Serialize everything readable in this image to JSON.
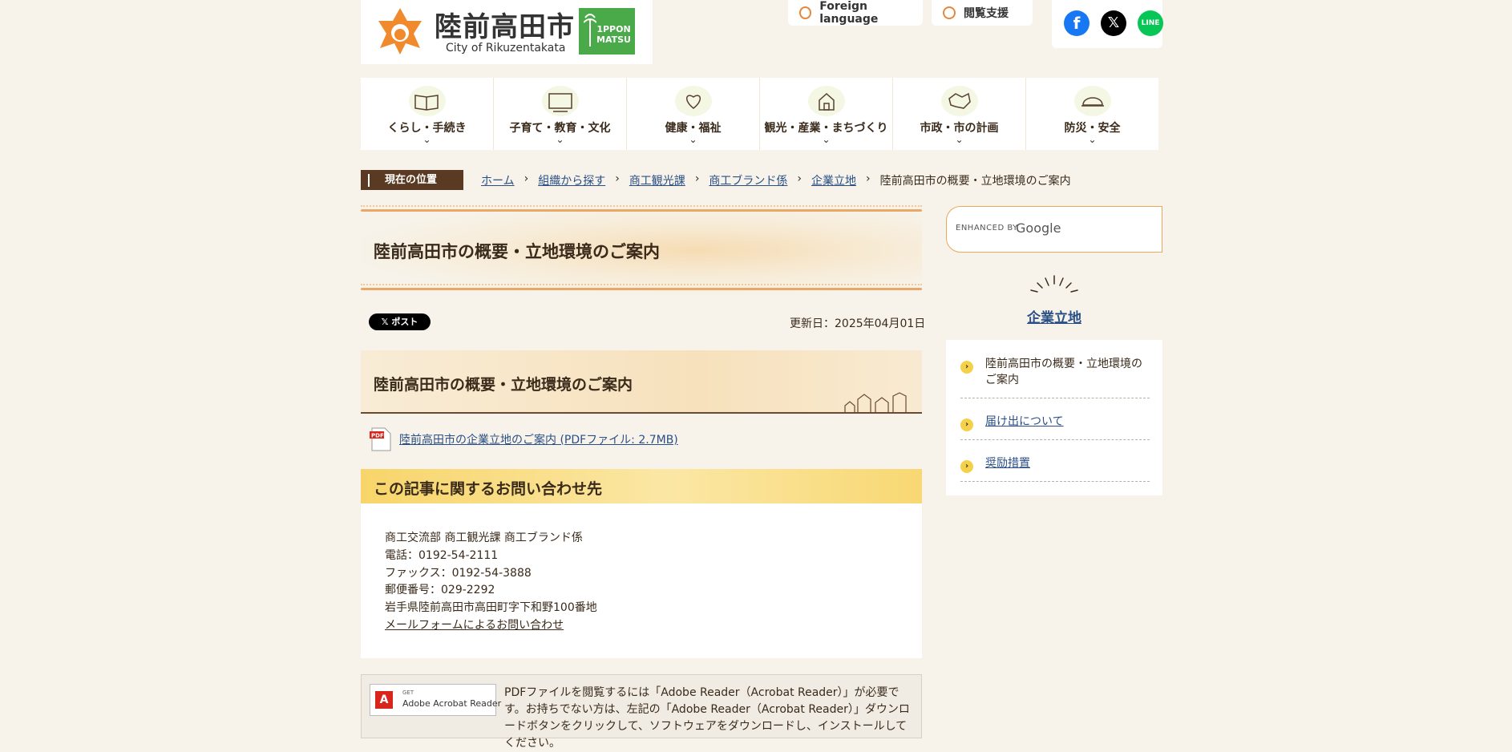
{
  "header": {
    "logo_name": "陸前高田市",
    "logo_sub": "City of Rikuzentakata",
    "ippon": [
      "1PPON",
      "MATSU"
    ],
    "foreign_label": "Foreign language",
    "eturan_label": "閲覧支援",
    "sns": {
      "x_glyph": "𝕏",
      "line_text": "LINE",
      "fb_glyph": "f"
    }
  },
  "nav": {
    "items": [
      {
        "label": "くらし・手続き",
        "icon": "book-pencil-icon"
      },
      {
        "label": "子育て・教育・文化",
        "icon": "blackboard-icon"
      },
      {
        "label": "健康・福祉",
        "icon": "hand-heart-icon"
      },
      {
        "label": "観光・産業・まちづくり",
        "icon": "town-icon"
      },
      {
        "label": "市政・市の計画",
        "icon": "map-icon"
      },
      {
        "label": "防災・安全",
        "icon": "helmet-icon"
      }
    ],
    "chevron": "⌄"
  },
  "breadcrumb": {
    "tag": "現在の位置",
    "items": [
      "ホーム",
      "組織から探す",
      "商工観光課",
      "商工ブランド係",
      "企業立地"
    ],
    "current": "陸前高田市の概要・立地環境のご案内",
    "sep": "›"
  },
  "main": {
    "title": "陸前高田市の概要・立地環境のご案内",
    "post_label": "𝕏 ポスト",
    "updated": "更新日：2025年04月01日",
    "h2": "陸前高田市の概要・立地環境のご案内",
    "pdf_link": "陸前高田市の企業立地のご案内 (PDFファイル: 2.7MB)",
    "contact": {
      "heading": "この記事に関するお問い合わせ先",
      "lines": [
        "商工交流部 商工観光課 商工ブランド係",
        "電話：0192-54-2111",
        "ファックス：0192-54-3888",
        "郵便番号：029-2292",
        "岩手県陸前高田市高田町字下和野100番地"
      ],
      "mail_link": "メールフォームによるお問い合わせ"
    },
    "adobe": {
      "get": "GET",
      "btn": "Adobe Acrobat Reader",
      "text": "PDFファイルを閲覧するには「Adobe Reader（Acrobat Reader）」が必要です。お持ちでない方は、左記の「Adobe Reader（Acrobat Reader）」ダウンロードボタンをクリックして、ソフトウェアをダウンロードし、インストールしてください。"
    }
  },
  "sidebar": {
    "search_enhanced": "ENHANCED BY",
    "search_google": "Google",
    "title": "企業立地",
    "items": [
      {
        "label": "陸前高田市の概要・立地環境のご案内",
        "link": false
      },
      {
        "label": "届け出について",
        "link": true
      },
      {
        "label": "奨励措置",
        "link": true
      }
    ],
    "bullet": "›"
  }
}
